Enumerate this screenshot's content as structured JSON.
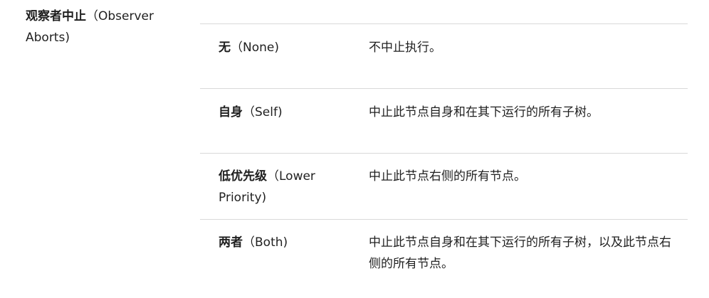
{
  "property": {
    "name_zh": "观察者中止",
    "name_en": "（Observer Aborts)"
  },
  "options": [
    {
      "name_zh": "无",
      "name_en": "（None)",
      "description": "不中止执行。"
    },
    {
      "name_zh": "自身",
      "name_en": "（Self)",
      "description": "中止此节点自身和在其下运行的所有子树。"
    },
    {
      "name_zh": "低优先级",
      "name_en": "（Lower Priority)",
      "description": "中止此节点右侧的所有节点。"
    },
    {
      "name_zh": "两者",
      "name_en": "（Both)",
      "description": "中止此节点自身和在其下运行的所有子树，以及此节点右侧的所有节点。"
    }
  ]
}
